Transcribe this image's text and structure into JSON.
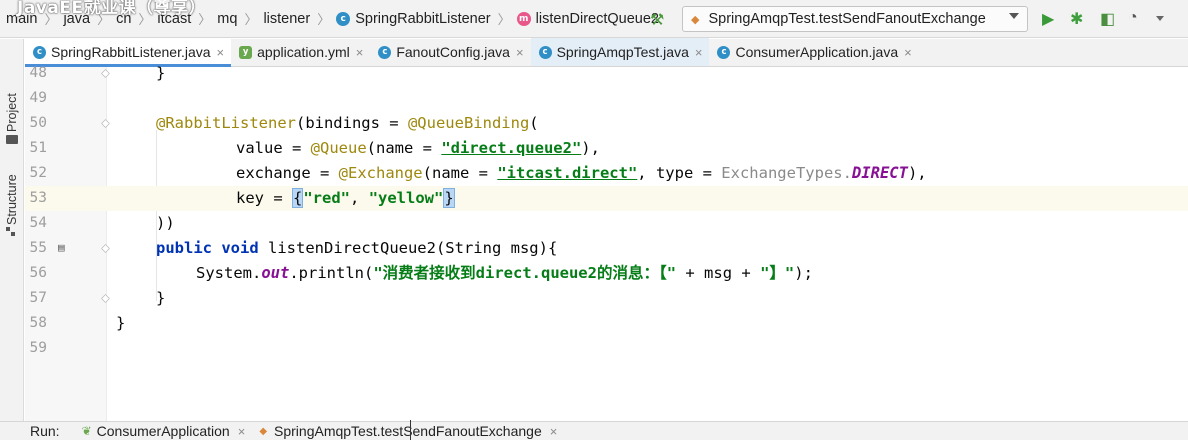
{
  "watermark": "JavaEE就业课（尊享）",
  "breadcrumb": {
    "items": [
      "main",
      "java",
      "cn",
      "itcast",
      "mq",
      "listener"
    ],
    "class_name": "SpringRabbitListener",
    "method_name": "listenDirectQueue2"
  },
  "run_config": {
    "label": "SpringAmqpTest.testSendFanoutExchange"
  },
  "toolstrip": {
    "project_label": "Project",
    "structure_label": "Structure"
  },
  "tabs": [
    {
      "label": "SpringRabbitListener.java",
      "icon": "class-icon",
      "active": true
    },
    {
      "label": "application.yml",
      "icon": "yaml-icon",
      "active": false
    },
    {
      "label": "FanoutConfig.java",
      "icon": "class-icon",
      "active": false
    },
    {
      "label": "SpringAmqpTest.java",
      "icon": "class-icon",
      "active": false
    },
    {
      "label": "ConsumerApplication.java",
      "icon": "class-icon",
      "active": false
    }
  ],
  "editor": {
    "line_numbers": [
      "48",
      "49",
      "50",
      "51",
      "52",
      "53",
      "54",
      "55",
      "56",
      "57",
      "58",
      "59"
    ],
    "lines": {
      "l48": "}",
      "l50_ann": "@RabbitListener",
      "l50_a": "(bindings = ",
      "l50_ann2": "@QueueBinding",
      "l50_b": "(",
      "l51_a": "value = ",
      "l51_ann": "@Queue",
      "l51_b": "(name = ",
      "l51_str": "\"direct.queue2\"",
      "l51_c": "),",
      "l52_a": "exchange = ",
      "l52_ann": "@Exchange",
      "l52_b": "(name = ",
      "l52_str": "\"itcast.direct\"",
      "l52_c": ", type = ",
      "l52_enumc": "ExchangeTypes.",
      "l52_enumv": "DIRECT",
      "l52_d": "),",
      "l53_a": "key = ",
      "l53_ob": "{",
      "l53_s1": "\"red\"",
      "l53_comma": ", ",
      "l53_s2": "\"yellow\"",
      "l53_cb": "}",
      "l54": "))",
      "l55_kw1": "public",
      "l55_kw2": "void",
      "l55_rest": " listenDirectQueue2(String msg){",
      "l56_a": "System.",
      "l56_out": "out",
      "l56_b": ".println(",
      "l56_str": "\"消费者接收到direct.queue2的消息：【\"",
      "l56_c": " + msg + ",
      "l56_str2": "\"】\"",
      "l56_d": ");",
      "l57": "}",
      "l58": "}"
    }
  },
  "run_bar": {
    "label": "Run:",
    "tabs": [
      "ConsumerApplication",
      "SpringAmqpTest.testSendFanoutExchange"
    ]
  },
  "colors": {
    "annotation": "#9e880d",
    "string": "#067d17",
    "keyword": "#0033b3",
    "field": "#871094",
    "accent": "#4b8ed8"
  }
}
